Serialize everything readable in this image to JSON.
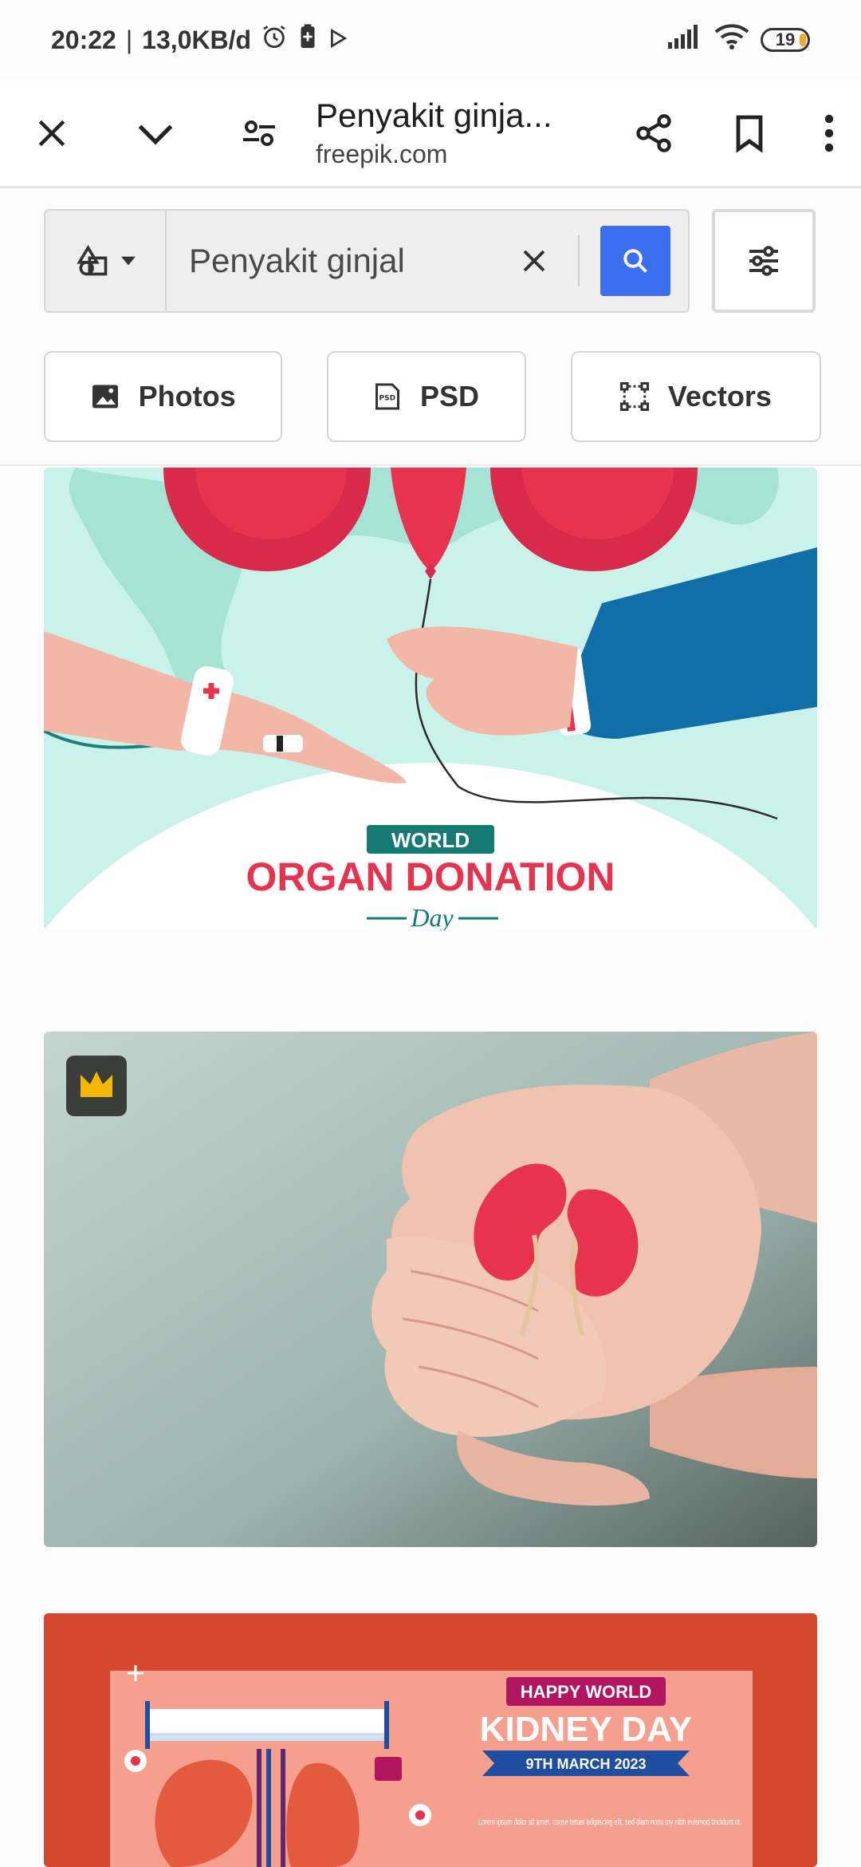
{
  "status_bar": {
    "time": "20:22",
    "separator": "|",
    "network_speed": "13,0KB/d",
    "battery_level": "19"
  },
  "browser": {
    "title": "Penyakit ginja...",
    "domain": "freepik.com"
  },
  "search": {
    "query": "Penyakit ginjal"
  },
  "filters": [
    {
      "label": "Photos",
      "icon": "image-icon"
    },
    {
      "label": "PSD",
      "icon": "psd-file-icon"
    },
    {
      "label": "Vectors",
      "icon": "vector-icon"
    }
  ],
  "results": [
    {
      "kind": "vector",
      "heading_small": "WORLD",
      "heading_main": "ORGAN DONATION",
      "heading_script": "Day"
    },
    {
      "kind": "photo",
      "premium": true
    },
    {
      "kind": "vector",
      "badge": "HAPPY WORLD",
      "heading_main": "KIDNEY DAY",
      "date_ribbon": "9TH MARCH 2023",
      "body_text": "Lorem ipsum dolor sit amet, conse tetuer adipiscing elit, sed diam nonu my nibh euismod tincidunt ut."
    }
  ],
  "colors": {
    "accent_blue": "#3b6ef0",
    "card1_bg": "#c9f3ea",
    "organ_red": "#e8334f",
    "card3_bg": "#d5472f",
    "premium_gold": "#f5b800"
  }
}
